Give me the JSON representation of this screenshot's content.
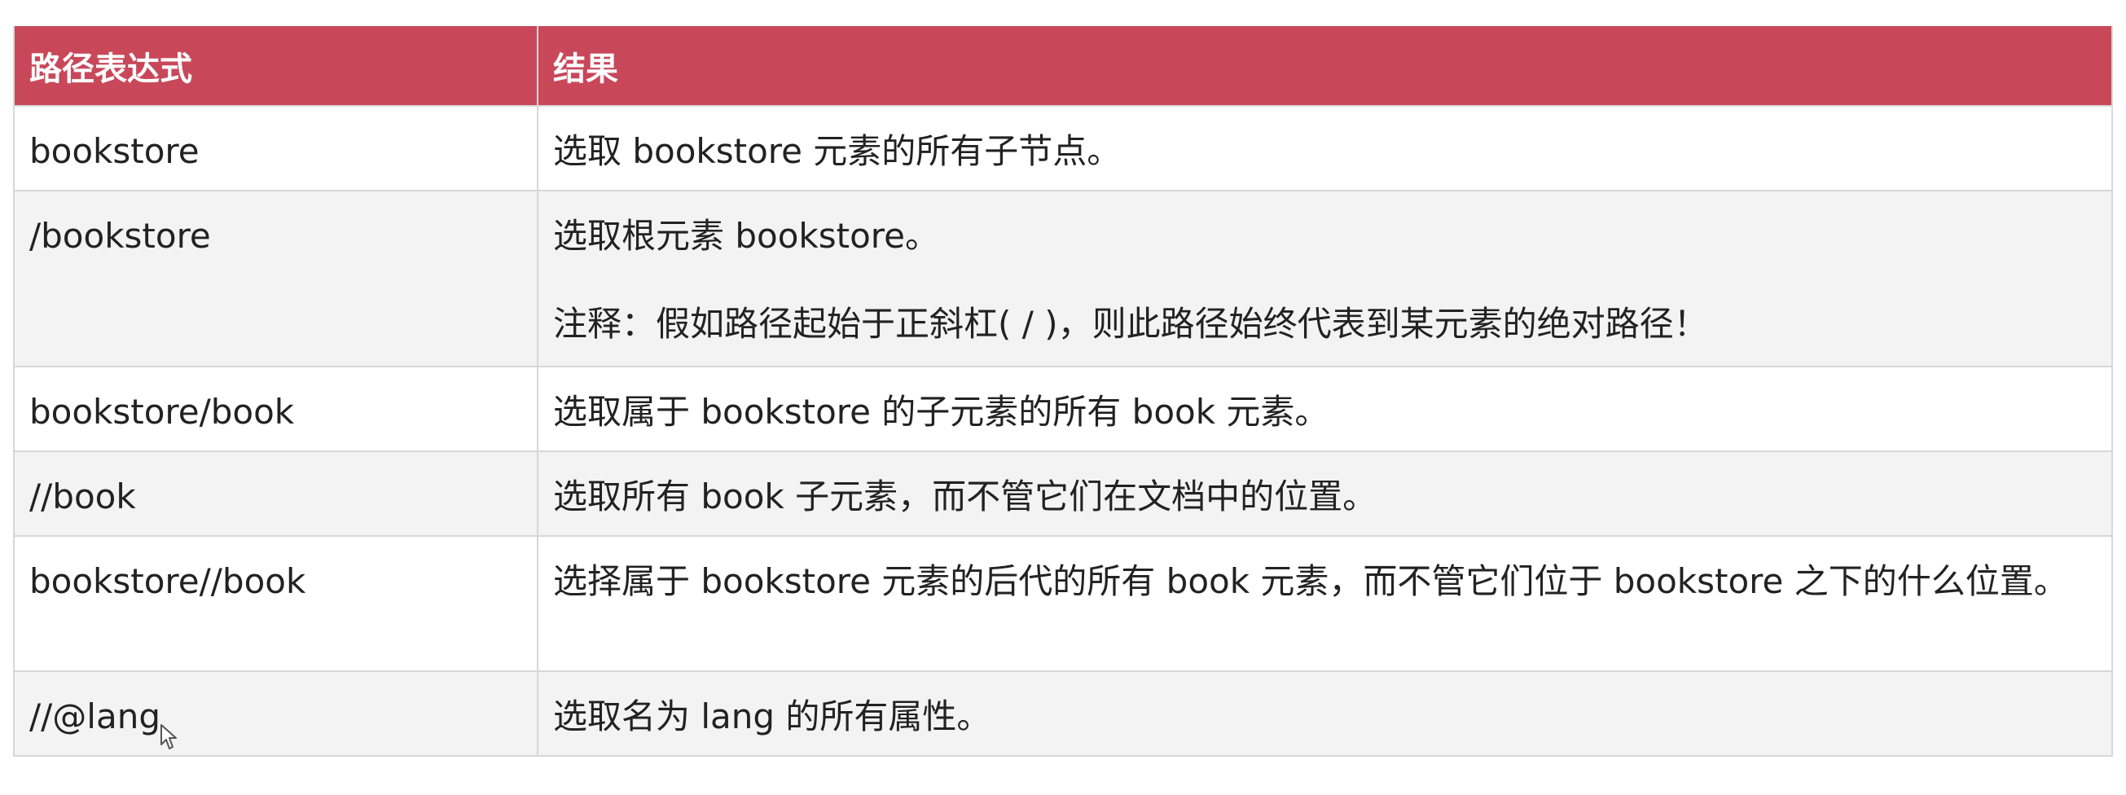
{
  "table": {
    "headers": [
      "路径表达式",
      "结果"
    ],
    "rows": [
      {
        "expression": "bookstore",
        "result": "选取 bookstore 元素的所有子节点。",
        "note": ""
      },
      {
        "expression": "/bookstore",
        "result": "选取根元素 bookstore。",
        "note": "注释：假如路径起始于正斜杠( / )，则此路径始终代表到某元素的绝对路径！"
      },
      {
        "expression": "bookstore/book",
        "result": "选取属于 bookstore 的子元素的所有 book 元素。",
        "note": ""
      },
      {
        "expression": "//book",
        "result": "选取所有 book 子元素，而不管它们在文档中的位置。",
        "note": ""
      },
      {
        "expression": "bookstore//book",
        "result": "选择属于 bookstore 元素的后代的所有 book 元素，而不管它们位于 bookstore 之下的什么位置。",
        "note": ""
      },
      {
        "expression": "//@lang",
        "result": "选取名为 lang 的所有属性。",
        "note": ""
      }
    ]
  },
  "colors": {
    "header_bg": "#c8485a",
    "header_text": "#ffffff",
    "row_alt_bg": "#f3f3f3",
    "border": "#d7d7d7"
  },
  "icons": {
    "cursor": "mouse-pointer-icon"
  }
}
